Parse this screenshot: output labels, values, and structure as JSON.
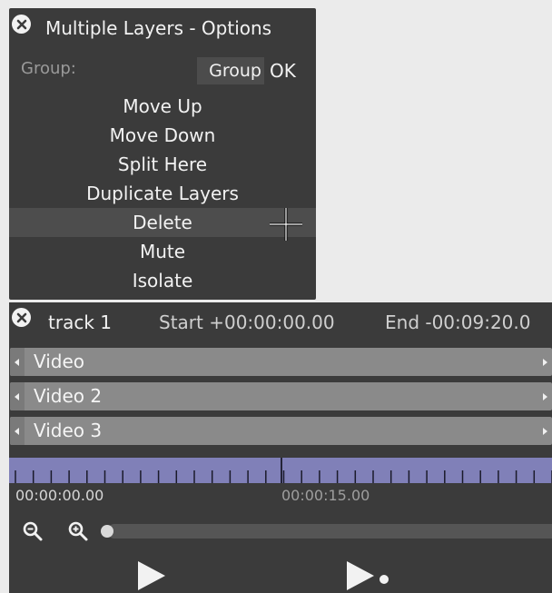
{
  "options_panel": {
    "title": "Multiple Layers - Options",
    "group_label": "Group:",
    "group_value": "Group",
    "ok_label": "OK",
    "menu_items": [
      {
        "label": "Move Up"
      },
      {
        "label": "Move Down"
      },
      {
        "label": "Split Here"
      },
      {
        "label": "Duplicate Layers"
      },
      {
        "label": "Delete",
        "highlighted": true
      },
      {
        "label": "Mute"
      },
      {
        "label": "Isolate"
      }
    ]
  },
  "track_panel": {
    "name": "track 1",
    "start_text": "Start +00:00:00.00",
    "end_text": "End -00:09:20.0",
    "layers": [
      {
        "label": "Video"
      },
      {
        "label": "Video 2"
      },
      {
        "label": "Video 3"
      }
    ],
    "timeline": {
      "start_label": "00:00:00.00",
      "mid_label": "00:00:15.00"
    }
  },
  "icons": {
    "close": "close-icon",
    "cursor": "crosshair-cursor",
    "zoom_out": "zoom-out-icon",
    "zoom_in": "zoom-in-icon",
    "play": "play-icon",
    "play_selection": "play-selection-icon"
  },
  "colors": {
    "panel_bg": "#3b3b3b",
    "page_bg": "#ebebeb",
    "layer_bar": "#8a8a8a",
    "timeline": "#8080b8",
    "highlight": "#4d4d4d"
  }
}
